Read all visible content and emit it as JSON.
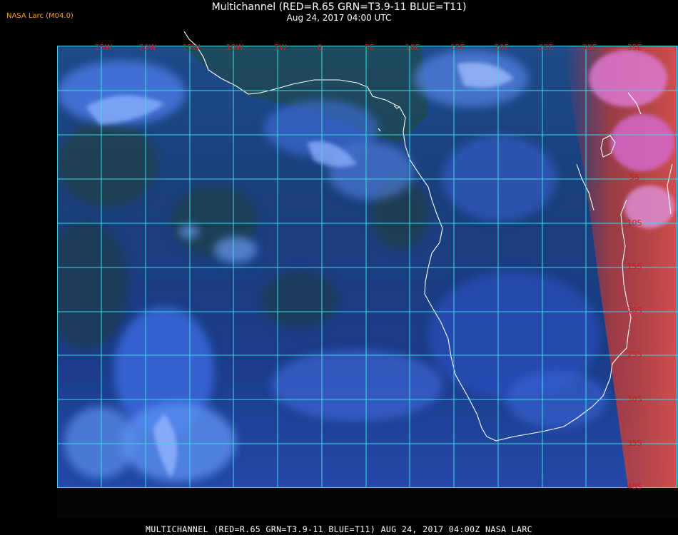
{
  "header": {
    "brand": "NASA Larc (M04.0)",
    "title": "Multichannel (RED=R.65 GRN=T3.9-11 BLUE=T11)",
    "timestamp": "Aug 24, 2017 04:00 UTC"
  },
  "footer": {
    "caption": "MULTICHANNEL (RED=R.65 GRN=T3.9-11 BLUE=T11) AUG 24, 2017 04:00Z    NASA LARC"
  },
  "map": {
    "grid_color": "#3fd9e8",
    "label_color": "#d21a1a",
    "coast_color": "#ffffff",
    "longitude_labels": [
      "25W",
      "20W",
      "15W",
      "10W",
      "5W",
      "0",
      "5E",
      "10E",
      "15E",
      "20E",
      "25E",
      "30E",
      "35E"
    ],
    "latitude_labels": [
      "5S",
      "10S",
      "15S",
      "20S",
      "25S",
      "30S",
      "35S",
      "40S"
    ]
  }
}
